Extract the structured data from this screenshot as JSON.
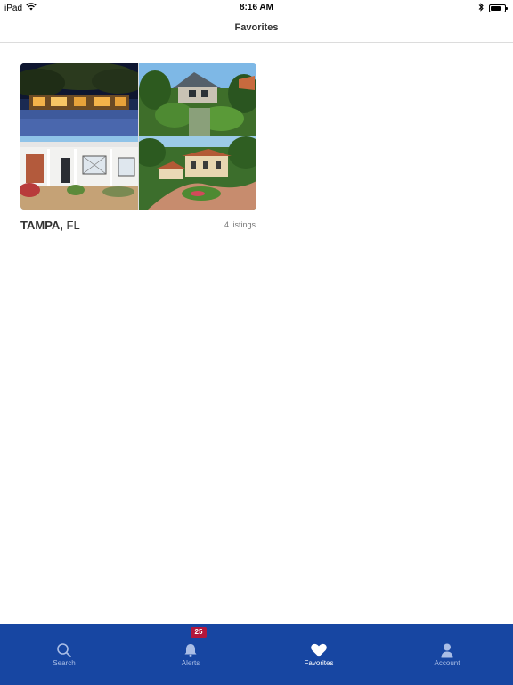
{
  "status_bar": {
    "device": "iPad",
    "time": "8:16 AM",
    "icons": [
      "wifi-icon",
      "bluetooth-icon",
      "battery-icon"
    ]
  },
  "nav": {
    "title": "Favorites"
  },
  "favorites": [
    {
      "city": "TAMPA,",
      "state": "FL",
      "count_label": "4 listings",
      "photos": [
        "night-driveway-house",
        "palm-garden-house",
        "white-porch-house",
        "aerial-estate-house"
      ]
    }
  ],
  "tabs": [
    {
      "label": "Search",
      "icon": "search-icon",
      "active": false
    },
    {
      "label": "Alerts",
      "icon": "bell-icon",
      "active": false,
      "badge": "25"
    },
    {
      "label": "Favorites",
      "icon": "heart-icon",
      "active": true
    },
    {
      "label": "Account",
      "icon": "person-icon",
      "active": false
    }
  ],
  "colors": {
    "tab_bar": "#1746a2",
    "tab_inactive": "#a9bde6",
    "tab_active": "#ffffff",
    "badge": "#b3173b"
  }
}
